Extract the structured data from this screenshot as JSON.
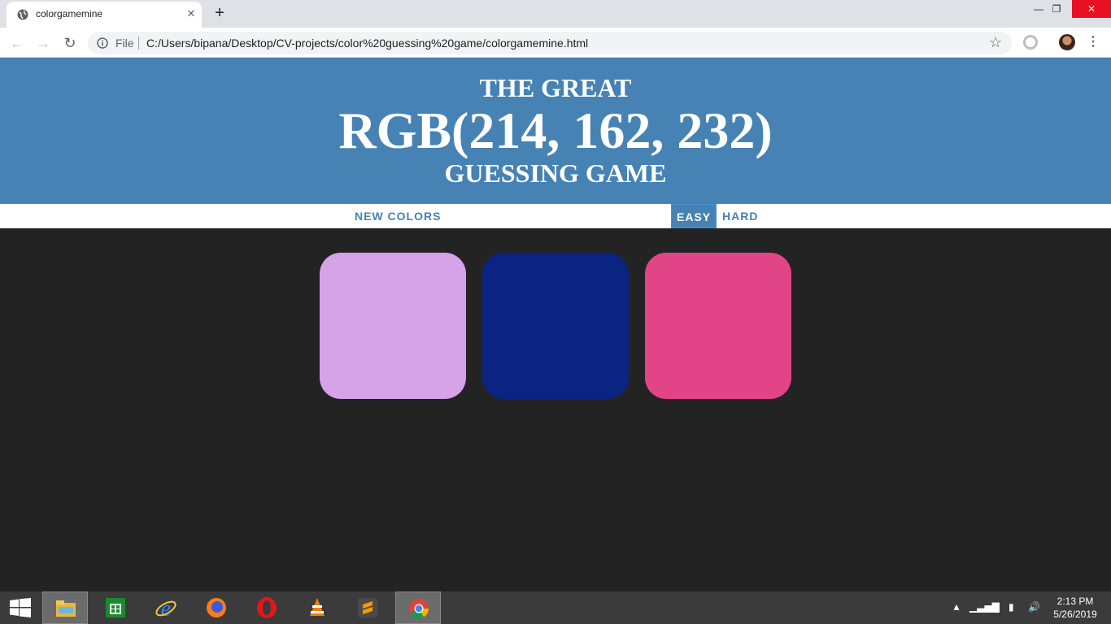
{
  "browser": {
    "tab_title": "colorgamemine",
    "tab_close": "✕",
    "new_tab": "+",
    "window_min": "—",
    "window_max": "❐",
    "window_close": "✕",
    "file_label": "File",
    "url": "C:/Users/bipana/Desktop/CV-projects/color%20guessing%20game/colorgamemine.html",
    "icons": [
      "back-arrow-icon",
      "forward-arrow-icon",
      "reload-icon",
      "info-icon",
      "star-icon",
      "extension-icon",
      "avatar",
      "menu-icon"
    ]
  },
  "game": {
    "title_top": "THE GREAT",
    "rgb_display": "RGB(214, 162, 232)",
    "title_bottom": "GUESSING GAME",
    "new_colors_label": "NEW COLORS",
    "easy_label": "EASY",
    "hard_label": "HARD",
    "selected_mode": "EASY",
    "header_color": "#4682b4",
    "background_color": "#232323",
    "squares": [
      {
        "color": "#d6a2e8"
      },
      {
        "color": "#0b2481"
      },
      {
        "color": "#e14487"
      }
    ]
  },
  "taskbar": {
    "apps": [
      "file-explorer-icon",
      "store-icon",
      "internet-explorer-icon",
      "firefox-icon",
      "opera-icon",
      "vlc-icon",
      "sublime-text-icon",
      "chrome-icon"
    ],
    "active_app": "chrome-icon",
    "time": "2:13 PM",
    "date": "5/26/2019"
  }
}
